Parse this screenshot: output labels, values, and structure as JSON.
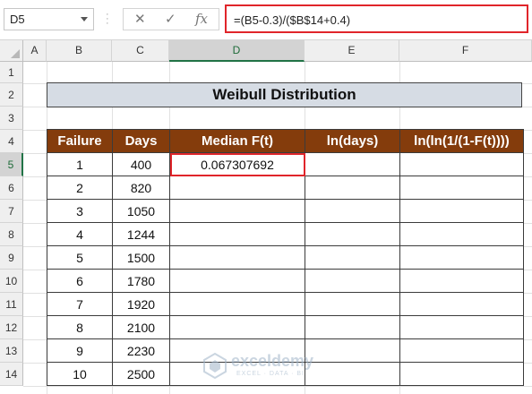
{
  "formula_bar": {
    "name_box": "D5",
    "formula": "=(B5-0.3)/($B$14+0.4)",
    "cancel_icon": "close-icon",
    "enter_icon": "check-icon",
    "fx_label": "fx"
  },
  "columns": [
    "A",
    "B",
    "C",
    "D",
    "E",
    "F"
  ],
  "rows": [
    "1",
    "2",
    "3",
    "4",
    "5",
    "6",
    "7",
    "8",
    "9",
    "10",
    "11",
    "12",
    "13",
    "14"
  ],
  "sheet": {
    "title": "Weibull Distribution",
    "headers": [
      "Failure",
      "Days",
      "Median F(t)",
      "ln(days)",
      "ln(ln(1/(1-F(t))))"
    ],
    "data": [
      [
        "1",
        "400",
        "0.067307692",
        "",
        ""
      ],
      [
        "2",
        "820",
        "",
        "",
        ""
      ],
      [
        "3",
        "1050",
        "",
        "",
        ""
      ],
      [
        "4",
        "1244",
        "",
        "",
        ""
      ],
      [
        "5",
        "1500",
        "",
        "",
        ""
      ],
      [
        "6",
        "1780",
        "",
        "",
        ""
      ],
      [
        "7",
        "1920",
        "",
        "",
        ""
      ],
      [
        "8",
        "2100",
        "",
        "",
        ""
      ],
      [
        "9",
        "2230",
        "",
        "",
        ""
      ],
      [
        "10",
        "2500",
        "",
        "",
        ""
      ]
    ]
  },
  "watermark": {
    "name": "exceldemy",
    "tagline": "EXCEL · DATA · BI"
  },
  "colors": {
    "header_fill": "#843c0c",
    "title_fill": "#d6dce4",
    "highlight": "#e0252a",
    "selection": "#217346"
  }
}
